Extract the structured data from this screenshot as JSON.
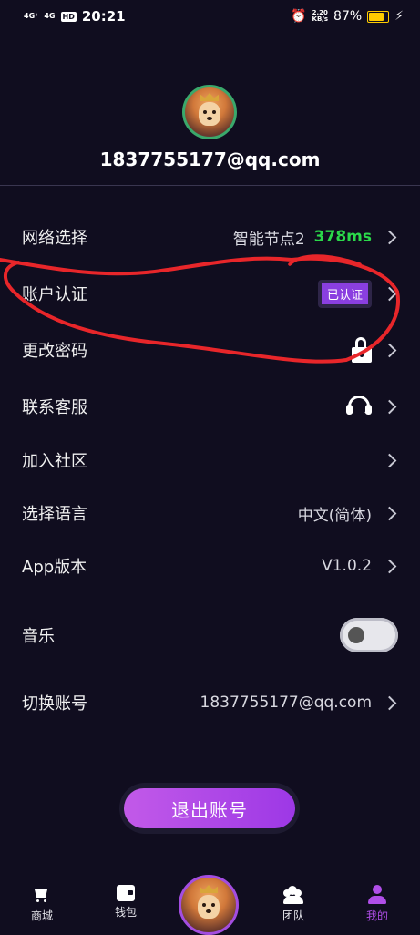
{
  "status_bar": {
    "network_1": "4G⁺",
    "network_2": "4G",
    "hd": "HD",
    "time": "20:21",
    "speed_value": "2.20",
    "speed_unit": "KB/s",
    "battery": "87%",
    "battery_level": 0.87
  },
  "profile": {
    "email": "1837755177@qq.com"
  },
  "menu": {
    "network": {
      "label": "网络选择",
      "node": "智能节点2",
      "latency": "378ms"
    },
    "account_verify": {
      "label": "账户认证",
      "badge": "已认证"
    },
    "change_password": {
      "label": "更改密码"
    },
    "customer_service": {
      "label": "联系客服"
    },
    "join_community": {
      "label": "加入社区"
    },
    "language": {
      "label": "选择语言",
      "value": "中文(简体)"
    },
    "app_version": {
      "label": "App版本",
      "value": "V1.0.2"
    },
    "music": {
      "label": "音乐",
      "enabled": false
    },
    "switch_account": {
      "label": "切换账号",
      "value": "1837755177@qq.com"
    }
  },
  "logout": {
    "label": "退出账号"
  },
  "tabbar": {
    "shop": "商城",
    "wallet": "钱包",
    "team": "团队",
    "mine": "我的"
  },
  "colors": {
    "background": "#100d1f",
    "accent": "#b04ee8",
    "latency": "#2bd94a",
    "annotation": "#e8262a"
  }
}
